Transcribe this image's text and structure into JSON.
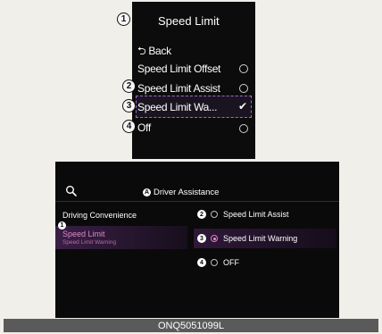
{
  "top_menu": {
    "title": "Speed Limit",
    "back": "⮌ Back",
    "items": [
      {
        "label": "Speed Limit Offset",
        "state": "radio"
      },
      {
        "label": "Speed Limit Assist",
        "state": "radio"
      },
      {
        "label": "Speed Limit Wa...",
        "state": "checked"
      },
      {
        "label": "Off",
        "state": "radio"
      }
    ],
    "callouts": [
      "1",
      "2",
      "3",
      "4"
    ]
  },
  "head_unit": {
    "header_marker": "A",
    "header_title": "Driver Assistance",
    "sidebar": {
      "items": [
        "Driving Convenience",
        "Speed Limit"
      ],
      "sub_label": "Speed Limit Warning",
      "marker": "1"
    },
    "options": [
      {
        "number": "2",
        "label": "Speed Limit Assist",
        "selected": false
      },
      {
        "number": "3",
        "label": "Speed Limit Warning",
        "selected": true
      },
      {
        "number": "4",
        "label": "OFF",
        "selected": false
      }
    ]
  },
  "caption": "ONQ5051099L",
  "colors": {
    "accent": "#e07bc6",
    "selection_border": "#a06ac8",
    "caption_bar": "#5a5a5a"
  }
}
